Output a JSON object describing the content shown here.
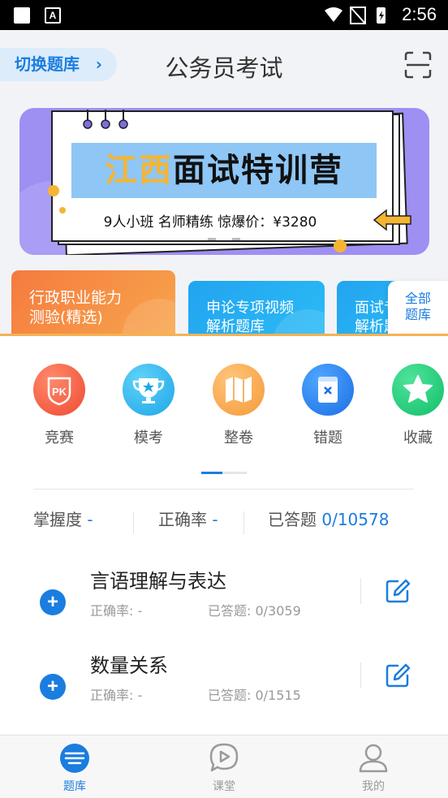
{
  "status_bar": {
    "time": "2:56"
  },
  "header": {
    "switch_label": "切换题库",
    "title": "公务员考试"
  },
  "banner": {
    "title_highlight": "江西",
    "title_rest": "面试特训营",
    "subtitle": "9人小班  名师精练  惊爆价：¥3280"
  },
  "categories": [
    {
      "line1": "行政职业能力",
      "line2": "测验(精选)"
    },
    {
      "line1": "申论专项视频",
      "line2": "解析题库"
    },
    {
      "line1": "面试专",
      "line2": "解析题"
    }
  ],
  "all_bank": {
    "line1": "全部",
    "line2": "题库"
  },
  "quick_entries": [
    {
      "label": "竞赛",
      "icon": "pk-icon",
      "badge": "PK"
    },
    {
      "label": "模考",
      "icon": "trophy-icon"
    },
    {
      "label": "整卷",
      "icon": "map-icon"
    },
    {
      "label": "错题",
      "icon": "wrong-book-icon"
    },
    {
      "label": "收藏",
      "icon": "star-icon"
    }
  ],
  "stats": {
    "mastery_label": "掌握度",
    "mastery_value": "-",
    "accuracy_label": "正确率",
    "accuracy_value": "-",
    "answered_label": "已答题",
    "answered_value": "0/10578"
  },
  "topics": [
    {
      "name": "言语理解与表达",
      "accuracy": "正确率: -",
      "answered": "已答题: 0/3059"
    },
    {
      "name": "数量关系",
      "accuracy": "正确率: -",
      "answered": "已答题: 0/1515"
    }
  ],
  "bottom_nav": [
    {
      "label": "题库",
      "active": true
    },
    {
      "label": "课堂",
      "active": false
    },
    {
      "label": "我的",
      "active": false
    }
  ],
  "colors": {
    "accent": "#1a7ddf",
    "orange": "#f57a3f",
    "banner": "#9e8ff3"
  }
}
